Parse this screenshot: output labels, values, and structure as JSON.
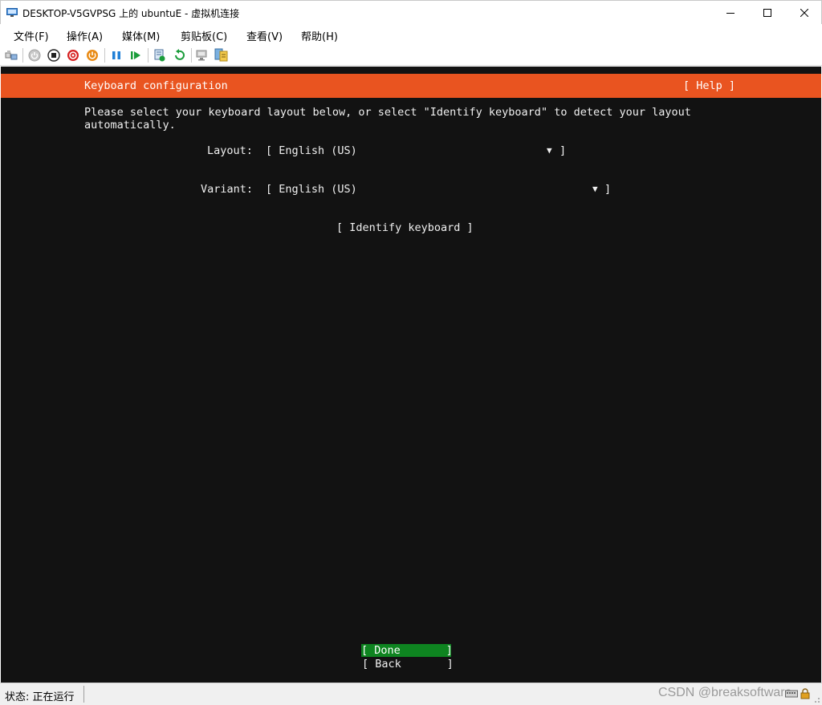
{
  "window": {
    "title": "DESKTOP-V5GVPSG 上的 ubuntuE - 虚拟机连接"
  },
  "menu": {
    "items": [
      "文件(F)",
      "操作(A)",
      "媒体(M)",
      "剪贴板(C)",
      "查看(V)",
      "帮助(H)"
    ]
  },
  "toolbar": {
    "icons": [
      "ctrl-alt-del-icon",
      "start-icon",
      "turn-off-icon",
      "shutdown-icon",
      "save-icon",
      "pause-icon",
      "resume-icon",
      "checkpoint-icon",
      "revert-icon",
      "enhanced-session-icon",
      "share-icon"
    ]
  },
  "installer": {
    "header_title": "Keyboard configuration",
    "help_label": "[ Help ]",
    "description_line1": "Please select your keyboard layout below, or select \"Identify keyboard\" to detect your layout",
    "description_line2": "automatically.",
    "layout_label": "Layout:",
    "layout_value": "[ English (US)",
    "layout_close": "]",
    "variant_label": "Variant:",
    "variant_value": "[ English (US)",
    "variant_close": "]",
    "identify_button": "[ Identify keyboard ]",
    "done_button": "[ Done       ]",
    "back_button": "[ Back       ]",
    "dropdown_arrow": "▼"
  },
  "status": {
    "text": "状态: 正在运行"
  },
  "watermark": {
    "text": "CSDN @breaksoftware"
  }
}
